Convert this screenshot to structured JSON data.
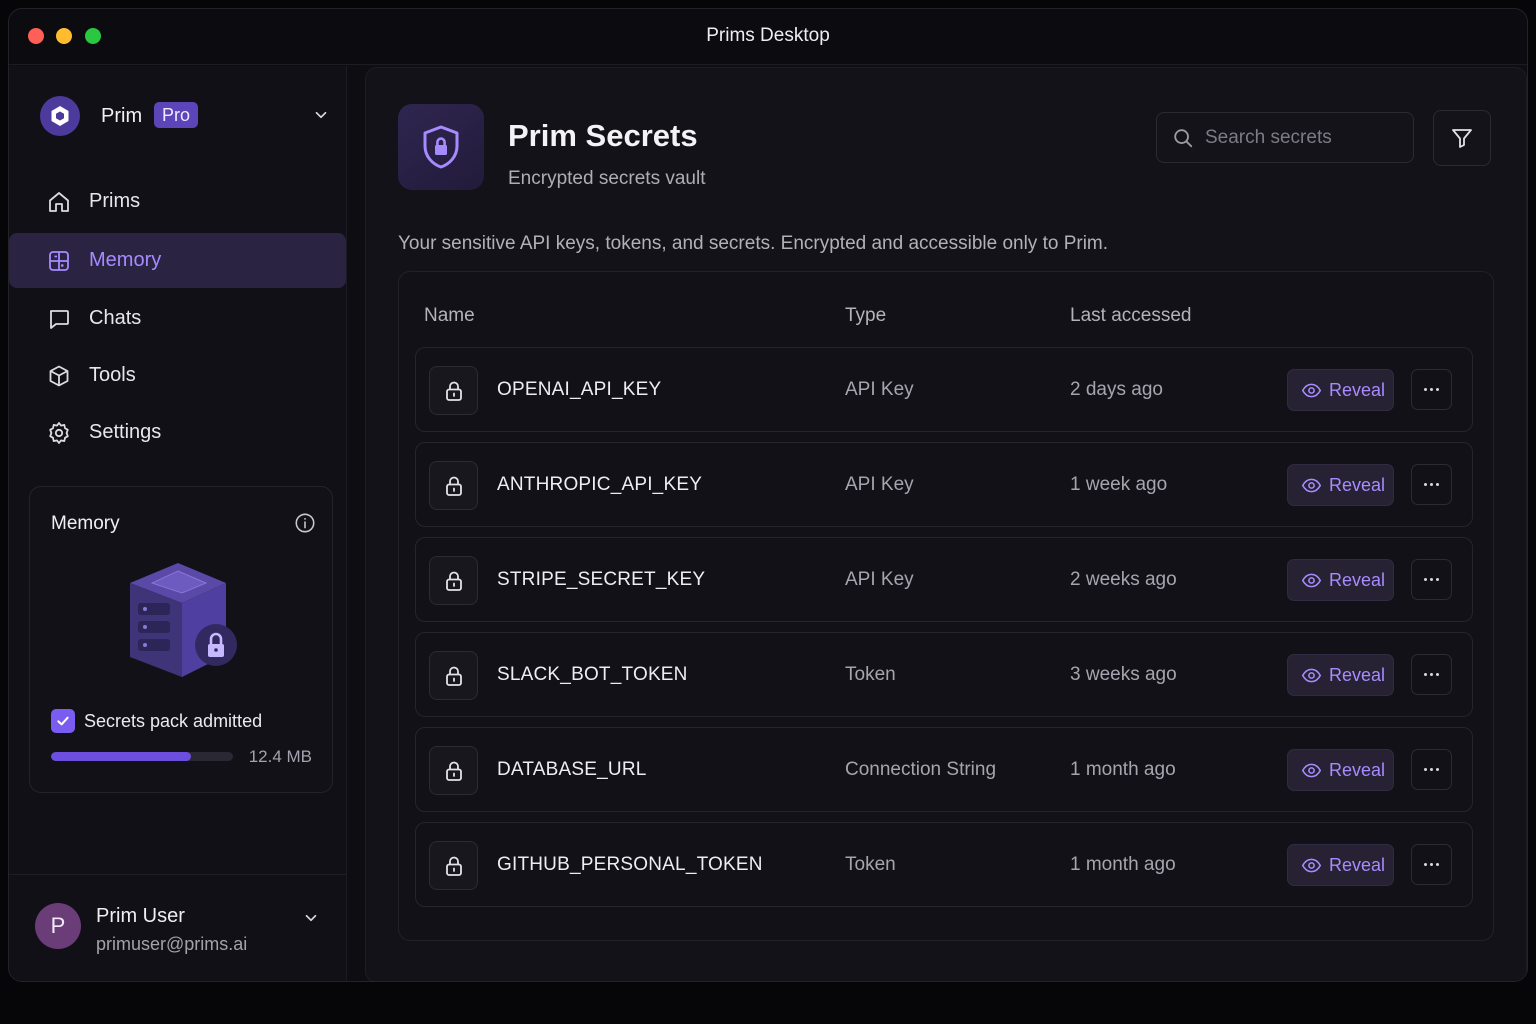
{
  "window": {
    "title": "Prims Desktop"
  },
  "workspace": {
    "name": "Prim",
    "badge": "Pro"
  },
  "nav": [
    {
      "label": "Prims",
      "icon": "home-icon"
    },
    {
      "label": "Memory",
      "icon": "grid-icon",
      "active": true
    },
    {
      "label": "Chats",
      "icon": "chat-icon"
    },
    {
      "label": "Tools",
      "icon": "cube-icon"
    },
    {
      "label": "Settings",
      "icon": "gear-icon"
    }
  ],
  "memory_card": {
    "title": "Memory",
    "check_label": "Secrets pack admitted",
    "checked": true,
    "size": "12.4 MB",
    "usage_fraction": 0.77
  },
  "user": {
    "initial": "P",
    "name": "Prim User",
    "email": "primuser@prims.ai"
  },
  "header": {
    "title": "Prim Secrets",
    "subtitle": "Encrypted secrets vault",
    "search_placeholder": "Search secrets",
    "description": "Your sensitive API keys, tokens, and secrets. Encrypted and accessible only to Prim."
  },
  "table": {
    "columns": [
      "Name",
      "Type",
      "Last accessed"
    ],
    "reveal_label": "Reveal",
    "rows": [
      {
        "name": "OPENAI_API_KEY",
        "type": "API Key",
        "last": "2 days ago"
      },
      {
        "name": "ANTHROPIC_API_KEY",
        "type": "API Key",
        "last": "1 week ago"
      },
      {
        "name": "STRIPE_SECRET_KEY",
        "type": "API Key",
        "last": "2 weeks ago"
      },
      {
        "name": "SLACK_BOT_TOKEN",
        "type": "Token",
        "last": "3 weeks ago"
      },
      {
        "name": "DATABASE_URL",
        "type": "Connection String",
        "last": "1 month ago"
      },
      {
        "name": "GITHUB_PERSONAL_TOKEN",
        "type": "Token",
        "last": "1 month ago"
      }
    ]
  },
  "colors": {
    "accent": "#7b5cf0",
    "accent_text": "#a78bff",
    "active_nav_bg": "#2a2342"
  }
}
